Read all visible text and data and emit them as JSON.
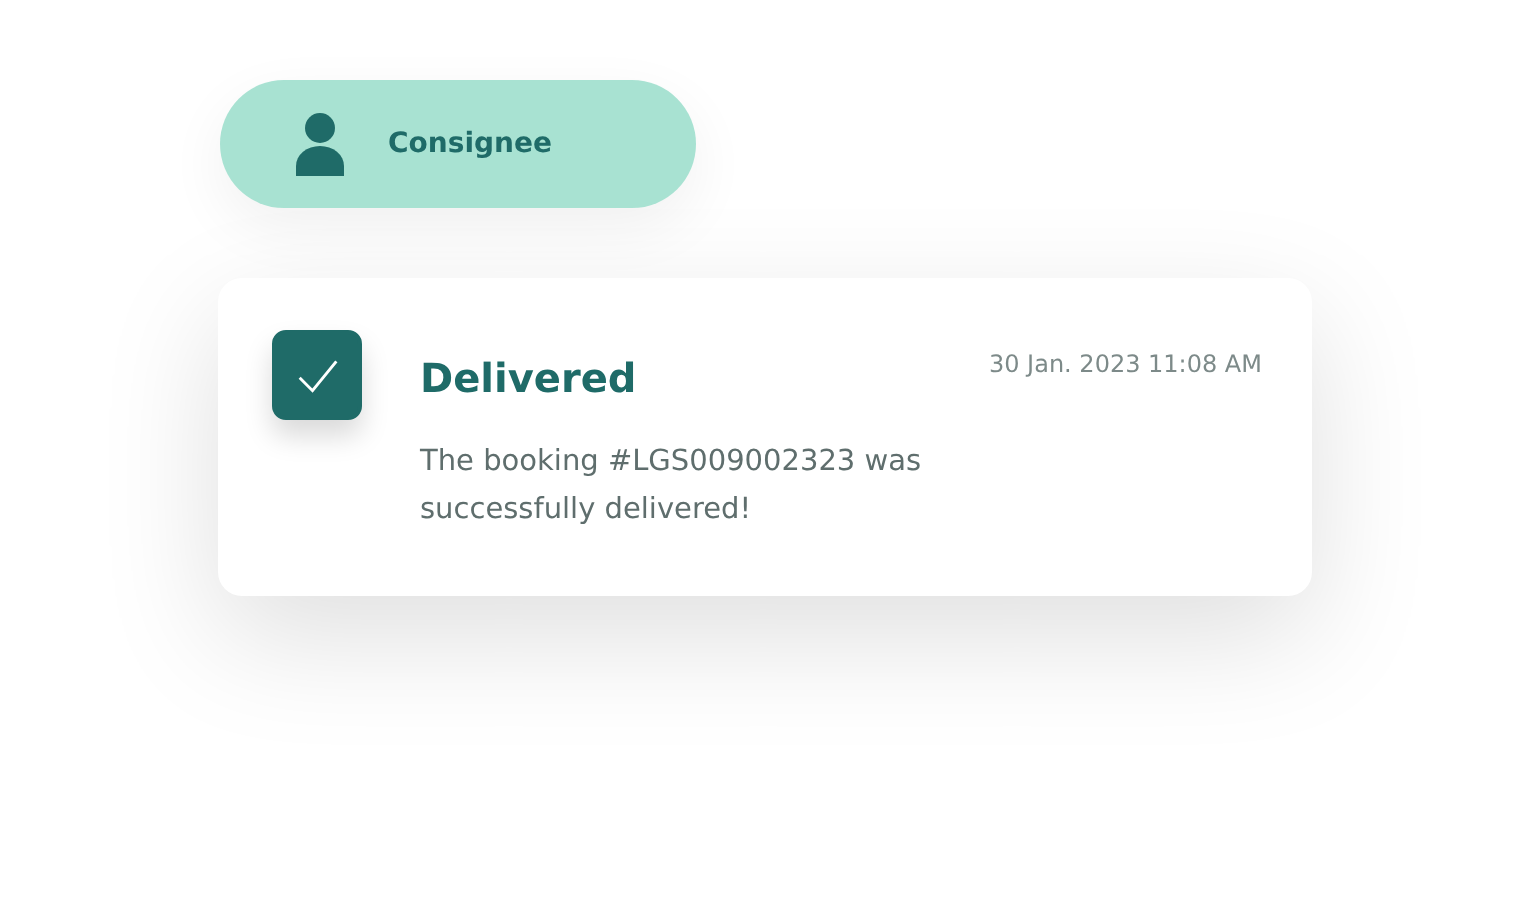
{
  "role_chip": {
    "label": "Consignee"
  },
  "notification": {
    "checked": true,
    "title": "Delivered",
    "time": "30 Jan. 2023 11:08 AM",
    "message": "The booking #LGS009002323 was successfully delivered!"
  }
}
